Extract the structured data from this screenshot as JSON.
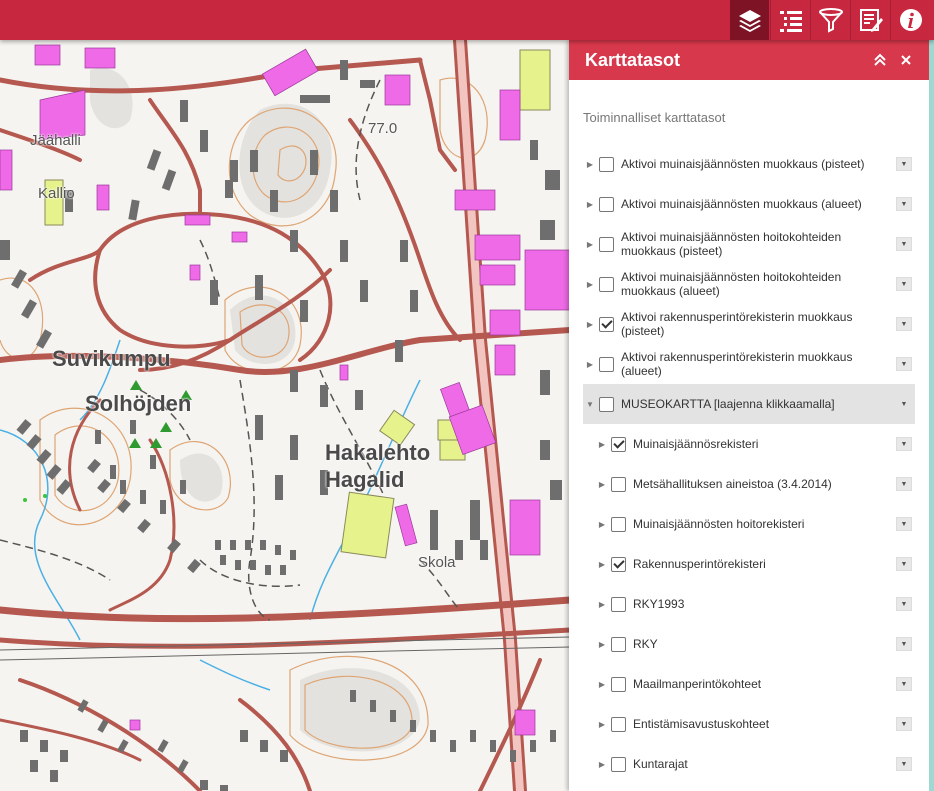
{
  "toolbar": {
    "tools": [
      {
        "name": "layers-icon",
        "active": true
      },
      {
        "name": "list-icon",
        "active": false
      },
      {
        "name": "filter-icon",
        "active": false
      },
      {
        "name": "edit-icon",
        "active": false
      },
      {
        "name": "info-icon",
        "active": false
      }
    ]
  },
  "panel": {
    "title": "Karttatasot",
    "section_title": "Toiminnalliset karttatasot",
    "layers": [
      {
        "label": "Aktivoi muinaisjäännösten muokkaus (pisteet)",
        "checked": false,
        "indent": 0
      },
      {
        "label": "Aktivoi muinaisjäännösten muokkaus (alueet)",
        "checked": false,
        "indent": 0
      },
      {
        "label": "Aktivoi muinaisjäännösten hoitokohteiden muokkaus (pisteet)",
        "checked": false,
        "indent": 0
      },
      {
        "label": "Aktivoi muinaisjäännösten hoitokohteiden muokkaus (alueet)",
        "checked": false,
        "indent": 0
      },
      {
        "label": "Aktivoi rakennusperintörekisterin muokkaus (pisteet)",
        "checked": true,
        "indent": 0
      },
      {
        "label": "Aktivoi rakennusperintörekisterin muokkaus (alueet)",
        "checked": false,
        "indent": 0
      },
      {
        "label": "MUSEOKARTTA [laajenna klikkaamalla]",
        "checked": false,
        "indent": 0,
        "group": true
      },
      {
        "label": "Muinaisjäännösrekisteri",
        "checked": true,
        "indent": 1
      },
      {
        "label": "Metsähallituksen aineistoa (3.4.2014)",
        "checked": false,
        "indent": 1
      },
      {
        "label": "Muinaisjäännösten hoitorekisteri",
        "checked": false,
        "indent": 1
      },
      {
        "label": "Rakennusperintörekisteri",
        "checked": true,
        "indent": 1
      },
      {
        "label": "RKY1993",
        "checked": false,
        "indent": 1
      },
      {
        "label": "RKY",
        "checked": false,
        "indent": 1
      },
      {
        "label": "Maailmanperintökohteet",
        "checked": false,
        "indent": 1
      },
      {
        "label": "Entistämisavustuskohteet",
        "checked": false,
        "indent": 1
      },
      {
        "label": "Kuntarajat",
        "checked": false,
        "indent": 1
      }
    ]
  },
  "map": {
    "labels": [
      {
        "text": "Jäähalli",
        "style": "small",
        "name": "map-label-jaahalli"
      },
      {
        "text": "Kallio",
        "style": "small",
        "name": "map-label-kallio"
      },
      {
        "text": "Suvikumpu",
        "style": "big",
        "name": "map-label-suvikumpu"
      },
      {
        "text": "Solhöjden",
        "style": "big",
        "name": "map-label-solhojden"
      },
      {
        "text": "Hakalehto",
        "style": "big",
        "name": "map-label-hakalehto"
      },
      {
        "text": "Hagalid",
        "style": "big",
        "name": "map-label-hagalid"
      },
      {
        "text": "Skola",
        "style": "small",
        "name": "map-label-skola"
      },
      {
        "text": "77.0",
        "style": "small",
        "name": "map-label-elevation"
      }
    ]
  },
  "colors": {
    "header": "#c8283f",
    "panel_header": "#d8384c",
    "road": "#b04a45",
    "building": "#6e6e6e",
    "public_building": "#ee6ae6",
    "field": "#e6f38c",
    "water": "#4ab0e6",
    "contour": "#d99a60",
    "marker": "#2f9a2f"
  }
}
